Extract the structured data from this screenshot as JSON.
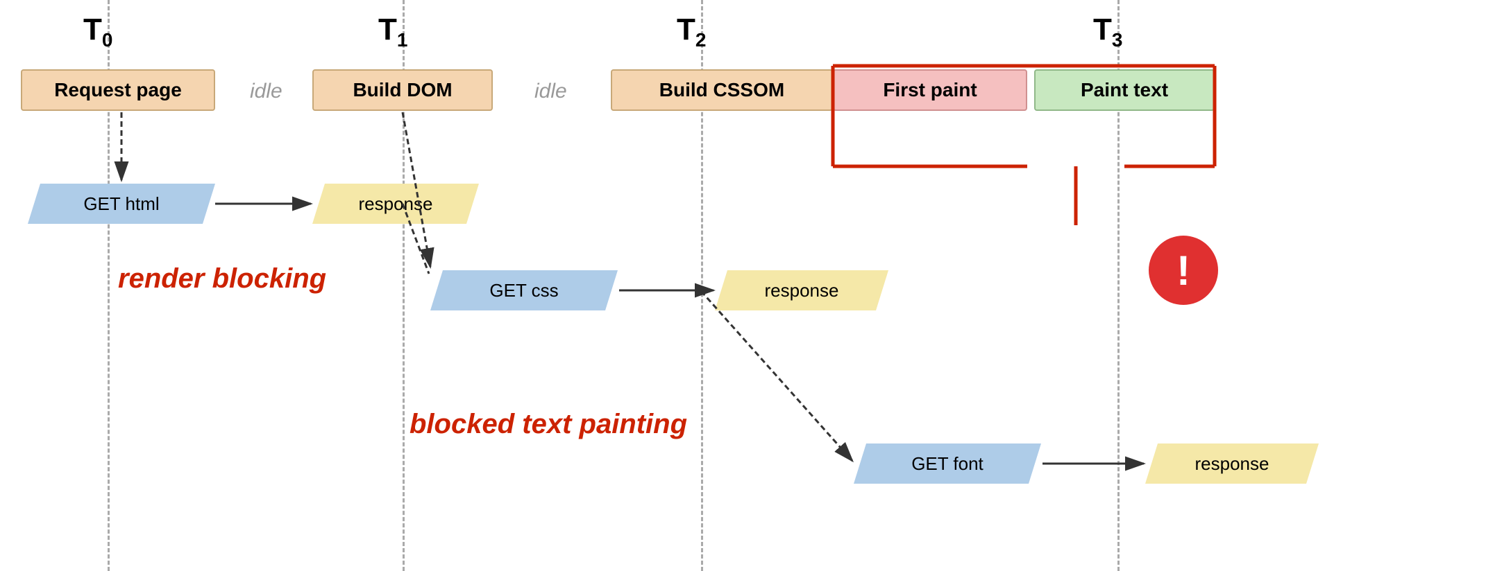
{
  "timeline": {
    "t0_label": "T",
    "t0_sub": "0",
    "t1_label": "T",
    "t1_sub": "1",
    "t2_label": "T",
    "t2_sub": "2",
    "t3_label": "T",
    "t3_sub": "3"
  },
  "process_boxes": {
    "request_page": "Request page",
    "build_dom": "Build DOM",
    "build_cssom": "Build CSSOM",
    "first_paint": "First paint",
    "paint_text": "Paint text"
  },
  "network_boxes": {
    "get_html": "GET html",
    "response1": "response",
    "get_css": "GET css",
    "response2": "response",
    "get_font": "GET font",
    "response3": "response"
  },
  "labels": {
    "idle1": "idle",
    "idle2": "idle",
    "render_blocking": "render blocking",
    "blocked_text_painting": "blocked text painting"
  },
  "exclaim": "!"
}
